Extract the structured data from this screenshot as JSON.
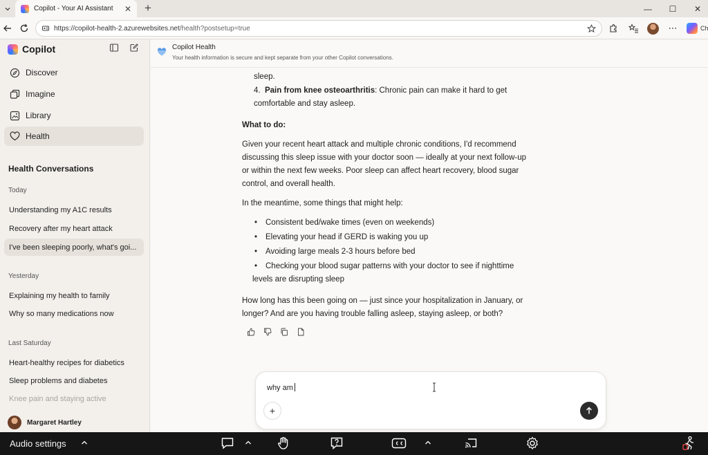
{
  "browser": {
    "tab_title": "Copilot - Your AI Assistant",
    "url_main": "https://copilot-health-2.azurewebsites.net",
    "url_rest": "/health?postsetup=true",
    "copilot_chip": "Cha"
  },
  "sidebar": {
    "brand": "Copilot",
    "nav": [
      {
        "label": "Discover"
      },
      {
        "label": "Imagine"
      },
      {
        "label": "Library"
      },
      {
        "label": "Health"
      }
    ],
    "section_title": "Health Conversations",
    "groups": [
      {
        "label": "Today",
        "items": [
          "Understanding my A1C results",
          "Recovery after my heart attack",
          "I've been sleeping poorly, what's goi..."
        ]
      },
      {
        "label": "Yesterday",
        "items": [
          "Explaining my health to family",
          "Why so many medications now"
        ]
      },
      {
        "label": "Last Saturday",
        "items": [
          "Heart-healthy recipes for diabetics",
          "Sleep problems and diabetes",
          "Knee pain and staying active"
        ]
      }
    ],
    "user_name": "Margaret Hartley"
  },
  "header": {
    "title": "Copilot Health",
    "subtitle": "Your health information is secure and kept separate from your other Copilot conversations."
  },
  "message": {
    "cut_line": "sleep.",
    "item4_num": "4.",
    "item4_bold": "Pain from knee osteoarthritis",
    "item4_rest_a": ": Chronic pain can make it hard to get",
    "item4_rest_b": "comfortable and stay asleep.",
    "what_to_do": "What to do:",
    "para1": [
      "Given your recent heart attack and multiple chronic conditions, I'd recommend",
      "discussing this sleep issue with your doctor soon — ideally at your next follow-up",
      "or within the next few weeks. Poor sleep can affect heart recovery, blood sugar",
      "control, and overall health."
    ],
    "para2": "In the meantime, some things that might help:",
    "bullets": [
      "Consistent bed/wake times (even on weekends)",
      "Elevating your head if GERD is waking you up",
      "Avoiding large meals 2-3 hours before bed",
      "Checking your blood sugar patterns with your doctor to see if nighttime",
      "levels are disrupting sleep"
    ],
    "para3": [
      "How long has this been going on — just since your hospitalization in January, or",
      "longer? And are you having trouble falling asleep, staying asleep, or both?"
    ]
  },
  "composer": {
    "value": "why am"
  },
  "bottombar": {
    "audio_label": "Audio settings"
  }
}
